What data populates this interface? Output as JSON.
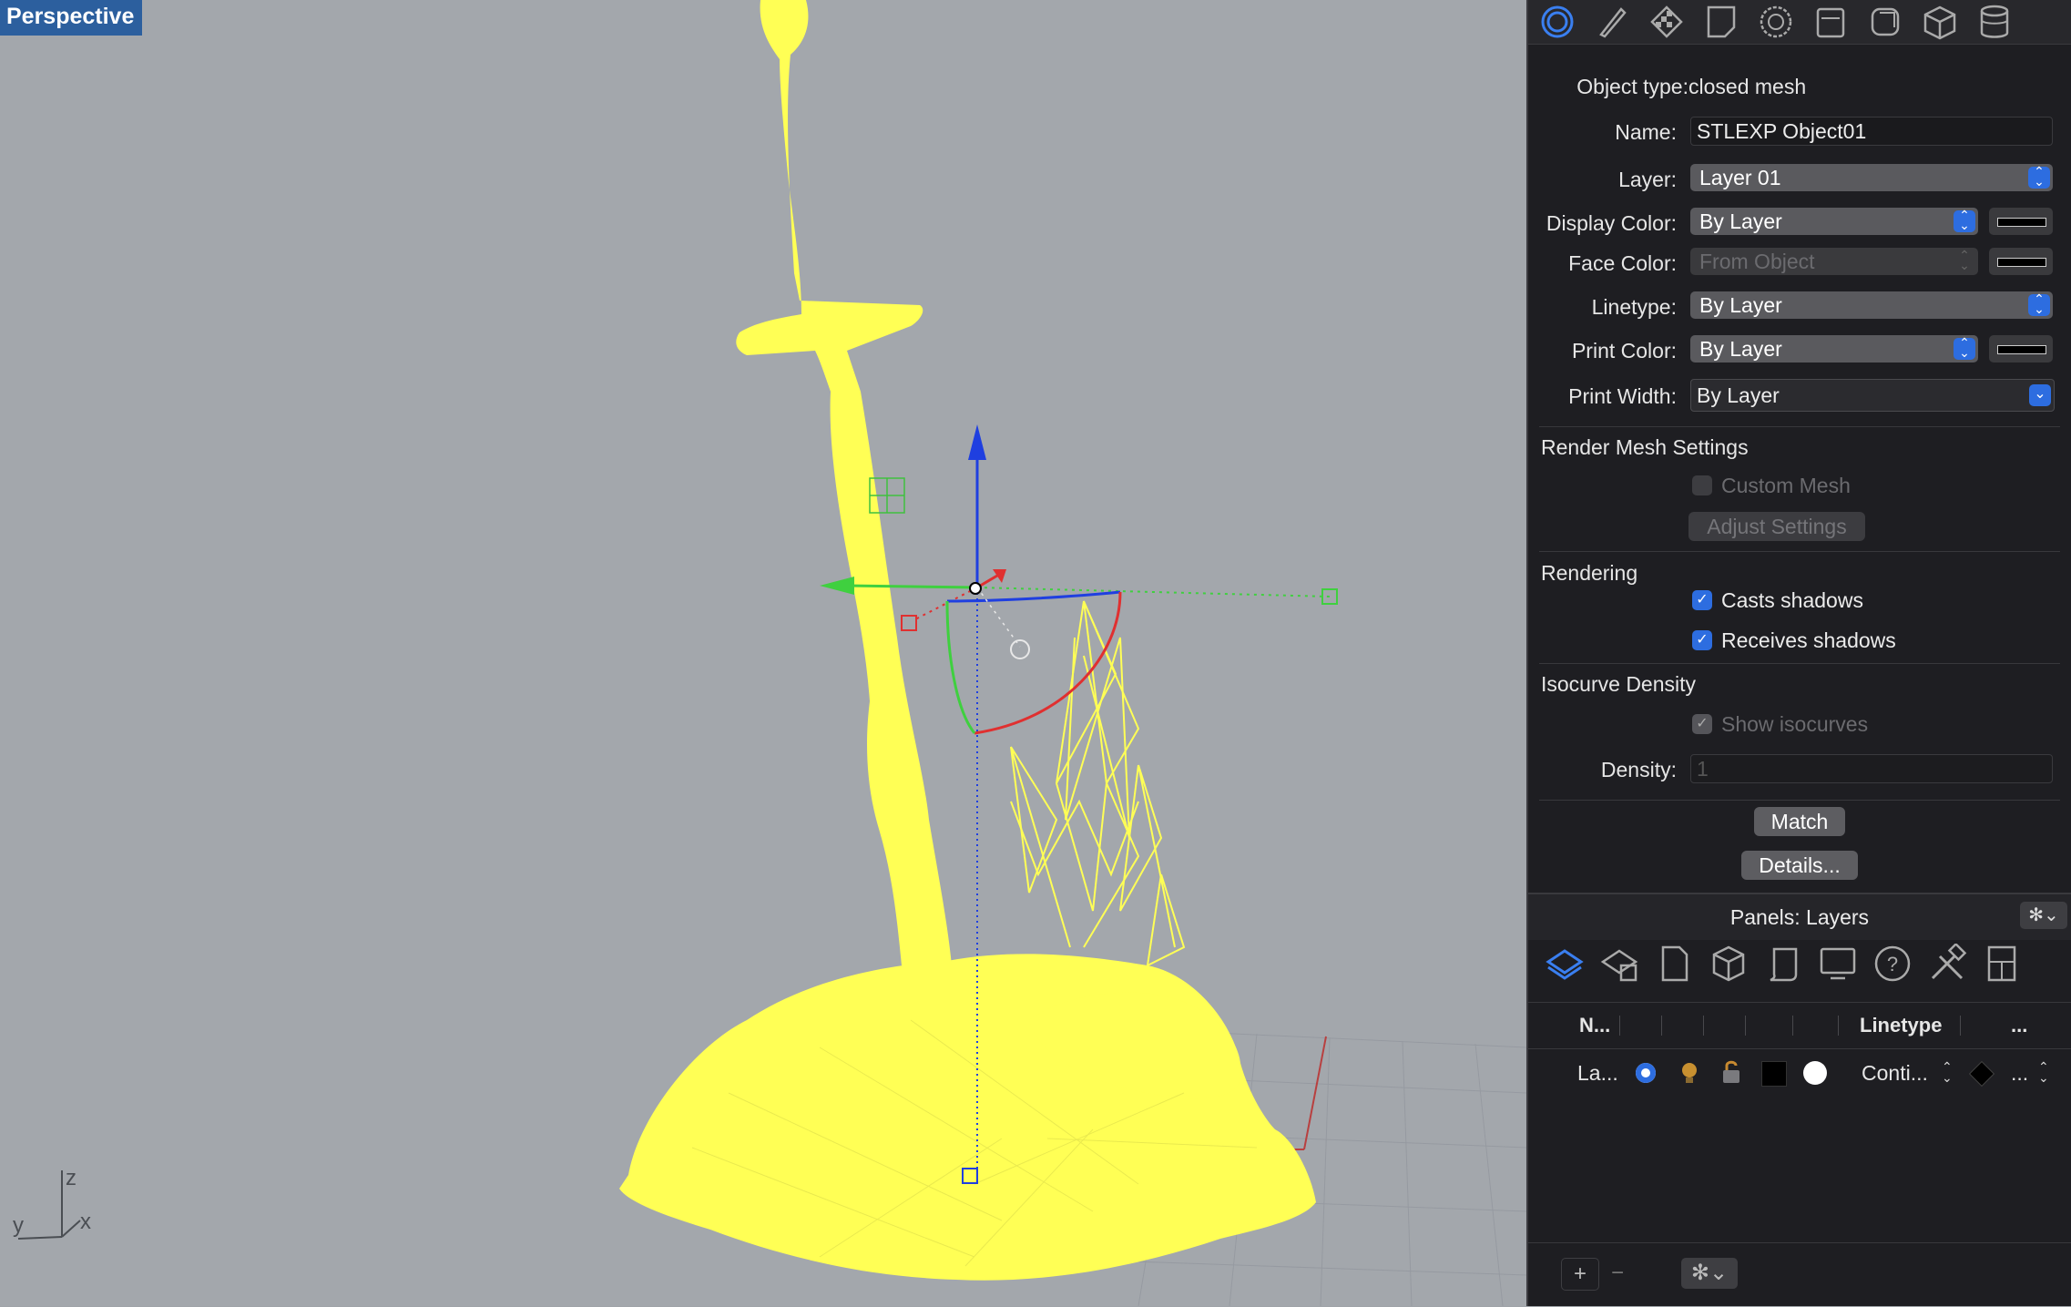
{
  "viewport": {
    "label": "Perspective",
    "axes": {
      "z": "z",
      "y": "y",
      "x": "x"
    }
  },
  "colors": {
    "mesh": "#ffff55",
    "accent": "#2d6de0",
    "viewport_bg": "#a3a7ac",
    "panel_bg": "#1e1e22"
  },
  "properties": {
    "tabs": [
      "object-icon",
      "brush-icon",
      "texture-icon",
      "page-icon",
      "environment-icon",
      "camera-icon",
      "view-icon",
      "cube-icon",
      "database-icon"
    ],
    "object_type_label": "Object type:",
    "object_type_value": "closed mesh",
    "name_label": "Name:",
    "name_value": "STLEXP Object01",
    "layer_label": "Layer:",
    "layer_value": "Layer 01",
    "display_color_label": "Display Color:",
    "display_color_value": "By Layer",
    "face_color_label": "Face Color:",
    "face_color_value": "From Object",
    "linetype_label": "Linetype:",
    "linetype_value": "By Layer",
    "print_color_label": "Print Color:",
    "print_color_value": "By Layer",
    "print_width_label": "Print Width:",
    "print_width_value": "By Layer",
    "render_mesh_title": "Render Mesh Settings",
    "custom_mesh_label": "Custom Mesh",
    "adjust_settings_label": "Adjust Settings",
    "rendering_title": "Rendering",
    "casts_shadows_label": "Casts shadows",
    "receives_shadows_label": "Receives shadows",
    "isocurve_title": "Isocurve Density",
    "show_isocurves_label": "Show isocurves",
    "density_label": "Density:",
    "density_value": "1",
    "match_label": "Match",
    "details_label": "Details..."
  },
  "layers_panel": {
    "title": "Panels: Layers",
    "tabs": [
      "layers-icon",
      "layer-states-icon",
      "page-icon",
      "cube-icon",
      "script-icon",
      "display-icon",
      "help-icon",
      "tools-icon",
      "grid-icon"
    ],
    "columns": {
      "name": "N...",
      "linetype": "Linetype",
      "more": "..."
    },
    "row": {
      "name": "La...",
      "linetype": "Conti...",
      "more": "..."
    },
    "add_label": "+",
    "remove_label": "−"
  }
}
